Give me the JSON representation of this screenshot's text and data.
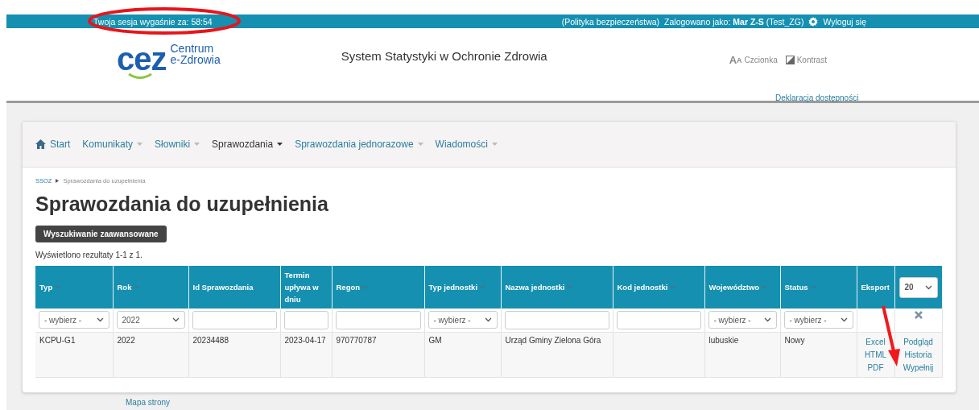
{
  "top_bar": {
    "session": "Twoja sesja wygaśnie za: 58:54",
    "policy": "(Polityka bezpieczeństwa)",
    "logged_label": "Zalogowano jako:",
    "user": "Mar Z-S",
    "user_login": "(Test_ZG)",
    "logout": "Wyloguj się"
  },
  "header": {
    "logo_mark": "cez",
    "logo_line1": "Centrum",
    "logo_line2": "e-Zdrowia",
    "system_title": "System Statystyki w Ochronie Zdrowia",
    "font_glyph": "A",
    "font_glyph_small": "A",
    "font_label": "Czcionka",
    "contrast_label": "Kontrast",
    "accessibility": "Deklaracja dostępności"
  },
  "nav": [
    {
      "label": "Start",
      "kind": "home",
      "selected": false
    },
    {
      "label": "Komunikaty",
      "kind": "dropdown",
      "selected": false
    },
    {
      "label": "Słowniki",
      "kind": "dropdown",
      "selected": false
    },
    {
      "label": "Sprawozdania",
      "kind": "dropdown",
      "selected": true
    },
    {
      "label": "Sprawozdania jednorazowe",
      "kind": "dropdown",
      "selected": false
    },
    {
      "label": "Wiadomości",
      "kind": "dropdown",
      "selected": false
    }
  ],
  "breadcrumb": [
    "SSOZ",
    "Sprawozdania do uzupełnienia"
  ],
  "heading": "Sprawozdania do uzupełnienia",
  "advanced_search_button": "Wyszukiwanie zaawansowane",
  "results_info": "Wyświetlono rezultaty 1-1 z 1.",
  "table": {
    "columns": [
      {
        "label": "Typ",
        "sortable": true,
        "filter": {
          "kind": "select",
          "value": "- wybierz -"
        }
      },
      {
        "label": "Rok",
        "sortable": true,
        "filter": {
          "kind": "select",
          "value": "2022"
        }
      },
      {
        "label": "Id Sprawozdania",
        "sortable": false,
        "filter": {
          "kind": "input"
        }
      },
      {
        "label": "Termin upływa w dniu",
        "sortable": false,
        "filter": {
          "kind": "input"
        }
      },
      {
        "label": "Regon",
        "sortable": true,
        "filter": {
          "kind": "input"
        }
      },
      {
        "label": "Typ jednostki",
        "sortable": true,
        "filter": {
          "kind": "select",
          "value": "- wybierz -"
        }
      },
      {
        "label": "Nazwa jednostki",
        "sortable": true,
        "filter": {
          "kind": "input"
        }
      },
      {
        "label": "Kod jednostki",
        "sortable": true,
        "filter": {
          "kind": "input"
        }
      },
      {
        "label": "Województwo",
        "sortable": true,
        "filter": {
          "kind": "select",
          "value": "- wybierz -"
        }
      },
      {
        "label": "Status",
        "sortable": true,
        "filter": {
          "kind": "select",
          "value": "- wybierz -"
        }
      },
      {
        "label": "Eksport",
        "sortable": false,
        "filter": {
          "kind": "none"
        }
      },
      {
        "filter": {
          "kind": "clear"
        }
      }
    ],
    "page_size": "20",
    "rows": [
      {
        "cells": [
          "KCPU-G1",
          "2022",
          "20234488",
          "2023-04-17",
          "970770787",
          "GM",
          "Urząd Gminy Zielona Góra",
          "",
          "lubuskie",
          "Nowy"
        ],
        "export_links": [
          "Excel",
          "HTML",
          "PDF"
        ],
        "actions": [
          "Podgląd",
          "Historia",
          "Wypełnij"
        ]
      }
    ]
  },
  "footer_link": "Mapa strony"
}
